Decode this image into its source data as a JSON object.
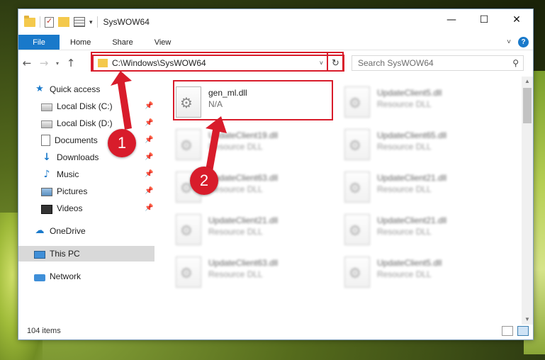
{
  "window": {
    "title": "SysWOW64",
    "minimize": "—",
    "maximize": "☐",
    "close": "✕"
  },
  "ribbon": {
    "tabs": [
      "File",
      "Home",
      "Share",
      "View"
    ],
    "help": "?"
  },
  "address": {
    "path": "C:\\Windows\\SysWOW64",
    "refresh": "↻"
  },
  "search": {
    "placeholder": "Search SysWOW64"
  },
  "nav": {
    "items": [
      {
        "label": "Quick access",
        "icon": "star-icon"
      },
      {
        "label": "Local Disk (C:)",
        "icon": "drive-icon",
        "pinned": true
      },
      {
        "label": "Local Disk (D:)",
        "icon": "drive-icon",
        "pinned": true
      },
      {
        "label": "Documents",
        "icon": "documents-icon",
        "pinned": true
      },
      {
        "label": "Downloads",
        "icon": "download-icon",
        "pinned": true
      },
      {
        "label": "Music",
        "icon": "music-icon",
        "pinned": true
      },
      {
        "label": "Pictures",
        "icon": "pictures-icon",
        "pinned": true
      },
      {
        "label": "Videos",
        "icon": "videos-icon",
        "pinned": true
      },
      {
        "label": "OneDrive",
        "icon": "cloud-icon"
      },
      {
        "label": "This PC",
        "icon": "computer-icon",
        "selected": true
      },
      {
        "label": "Network",
        "icon": "network-icon"
      }
    ]
  },
  "files": [
    {
      "name": "gen_ml.dll",
      "type": "N/A",
      "highlighted": true
    },
    {
      "name": "UpdateClient5.dll",
      "type": "Resource DLL",
      "blurred": true
    },
    {
      "name": "UpdateClient19.dll",
      "type": "Resource DLL",
      "blurred": true
    },
    {
      "name": "UpdateClient65.dll",
      "type": "Resource DLL",
      "blurred": true
    },
    {
      "name": "UpdateClient63.dll",
      "type": "Resource DLL",
      "blurred": true
    },
    {
      "name": "UpdateClient21.dll",
      "type": "Resource DLL",
      "blurred": true
    },
    {
      "name": "UpdateClient21.dll",
      "type": "Resource DLL",
      "blurred": true
    },
    {
      "name": "UpdateClient21.dll",
      "type": "Resource DLL",
      "blurred": true
    },
    {
      "name": "UpdateClient63.dll",
      "type": "Resource DLL",
      "blurred": true
    },
    {
      "name": "UpdateClient5.dll",
      "type": "Resource DLL",
      "blurred": true
    }
  ],
  "status": {
    "count": "104 items"
  },
  "annotations": {
    "marker1": "1",
    "marker2": "2",
    "color": "#d81c2b"
  }
}
